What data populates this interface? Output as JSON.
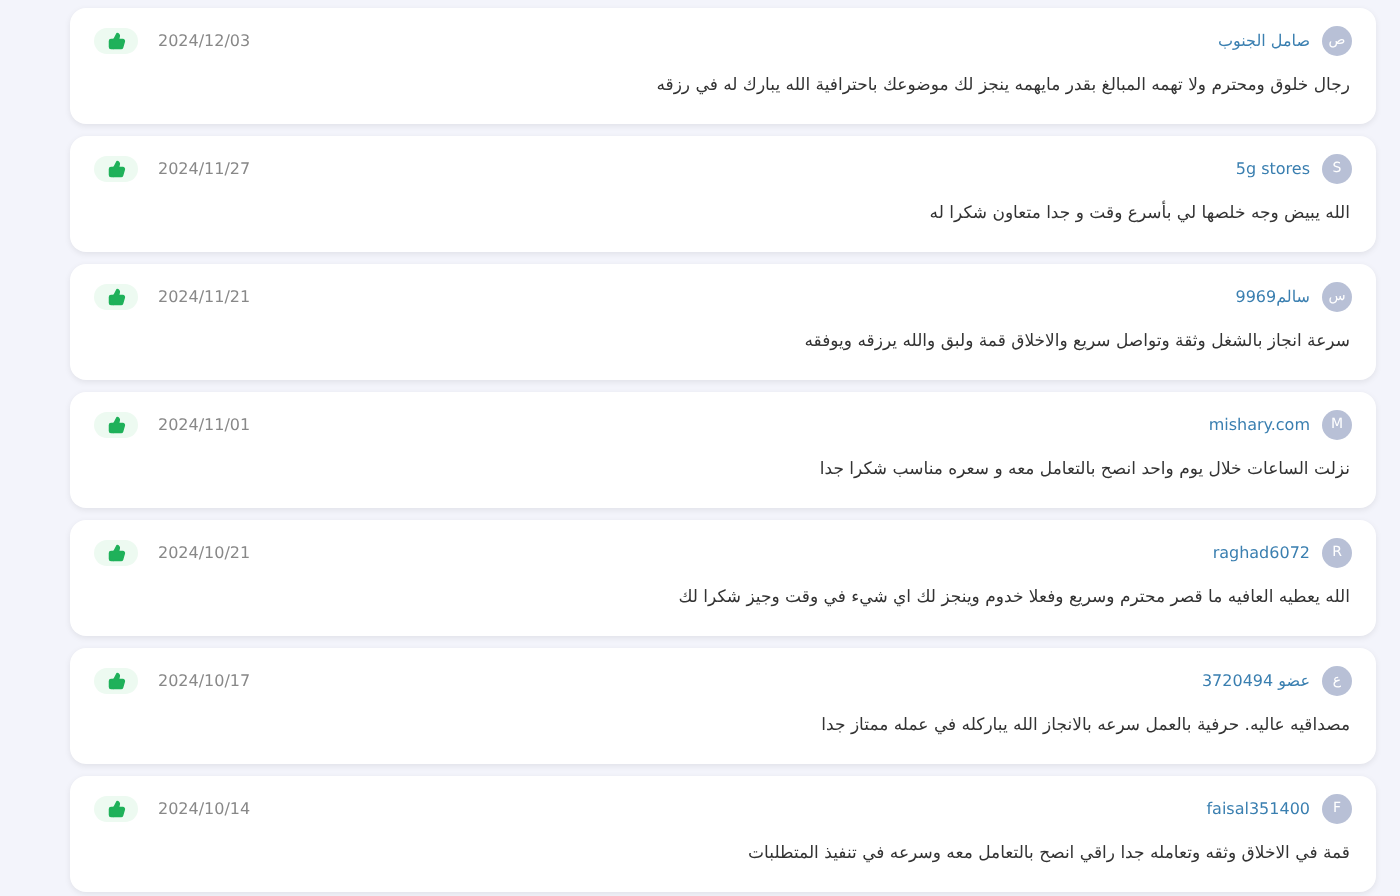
{
  "reviews": [
    {
      "initial": "ص",
      "name": "صامل الجنوب",
      "date": "2024/12/03",
      "comment": "رجال خلوق ومحترم ولا تهمه المبالغ بقدر مايهمه ينجز لك موضوعك باحترافية الله يبارك له في رزقه"
    },
    {
      "initial": "S",
      "name": "5g stores",
      "date": "2024/11/27",
      "comment": "الله يبيض وجه خلصها لي بأسرع وقت و جدا متعاون شكرا له"
    },
    {
      "initial": "س",
      "name": "سالم9969",
      "date": "2024/11/21",
      "comment": "سرعة انجاز بالشغل وثقة وتواصل سريع والاخلاق قمة ولبق والله يرزقه ويوفقه"
    },
    {
      "initial": "M",
      "name": "mishary.com",
      "date": "2024/11/01",
      "comment": "نزلت الساعات خلال يوم واحد انصح بالتعامل معه و سعره مناسب شكرا جدا"
    },
    {
      "initial": "R",
      "name": "raghad6072",
      "date": "2024/10/21",
      "comment": "الله يعطيه العافيه ما قصر محترم وسريع وفعلا خدوم وينجز لك اي شيء في وقت وجيز شكرا لك"
    },
    {
      "initial": "ع",
      "name": "عضو 3720494",
      "date": "2024/10/17",
      "comment": "مصداقيه عاليه. حرفية بالعمل سرعه بالانجاز الله يباركله في عمله ممتاز جدا"
    },
    {
      "initial": "F",
      "name": "faisal351400",
      "date": "2024/10/14",
      "comment": "قمة في الاخلاق وثقه وتعامله جدا راقي انصح بالتعامل معه وسرعه في تنفيذ المتطلبات"
    }
  ]
}
